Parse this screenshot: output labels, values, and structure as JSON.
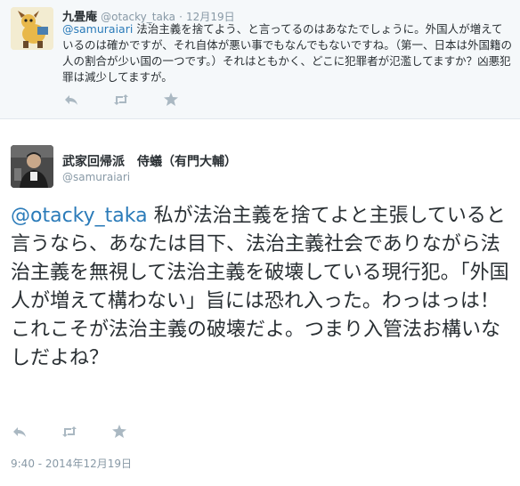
{
  "tweet1": {
    "name": "九畳庵",
    "handle": "@otacky_taka",
    "date": "12月19日",
    "mention": "@samuraiari",
    "text": " 法治主義を捨てよう、と言ってるのはあなたでしょうに。外国人が増えているのは確かですが、それ自体が悪い事でもなんでもないですね。（第一、日本は外国籍の人の割合が少い国の一つです。）それはともかく、どこに犯罪者が氾濫してますか？凶悪犯罪は減少してますが。",
    "actions": {
      "reply_icon": "reply-icon",
      "retweet_icon": "retweet-icon",
      "favorite_icon": "favorite-icon"
    }
  },
  "tweet2": {
    "name": "武家回帰派　侍蟻（有門大輔）",
    "handle": "@samuraiari",
    "mention": "@otacky_taka",
    "text": " 私が法治主義を捨てよと主張していると言うなら、あなたは目下、法治主義社会でありながら法治主義を無視して法治主義を破壊している現行犯。「外国人が増えて構わない」旨には恐れ入った。わっはっは！ これこそが法治主義の破壊だよ。つまり入管法お構いなしだよね？",
    "timestamp": "9:40 - 2014年12月19日"
  },
  "colors": {
    "link": "#2b7bb9",
    "muted": "#8899a6",
    "icon": "#aab8c2",
    "bg_top": "#f5f8fa"
  }
}
